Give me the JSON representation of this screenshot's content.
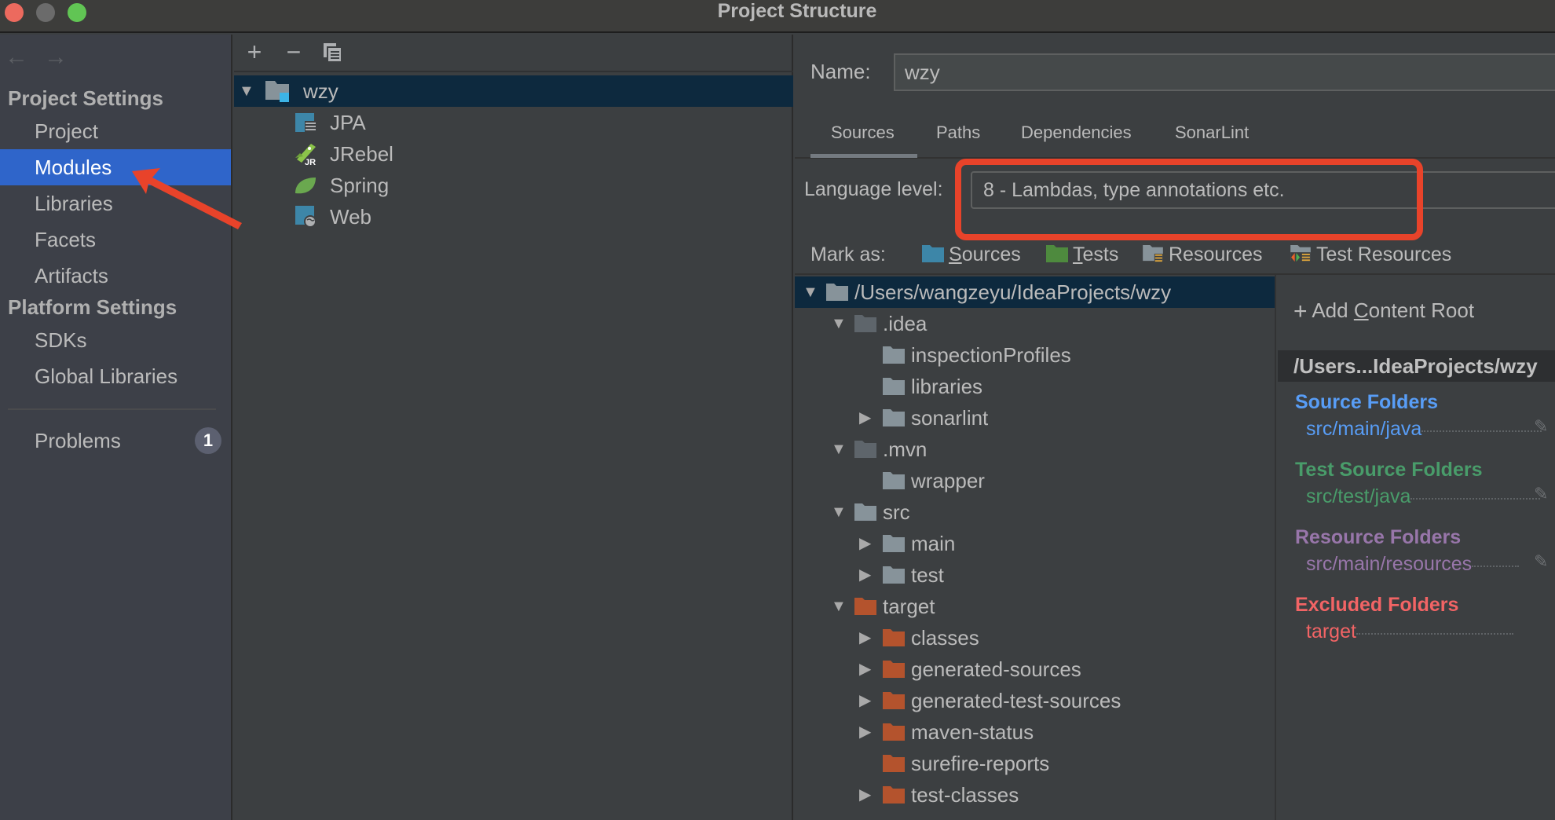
{
  "window": {
    "title": "Project Structure",
    "traffic_lights": [
      "close",
      "minimize",
      "maximize"
    ]
  },
  "sidebar": {
    "nav_back_icon": "←",
    "nav_forward_icon": "→",
    "sections": [
      {
        "heading": "Project Settings",
        "items": [
          "Project",
          "Modules",
          "Libraries",
          "Facets",
          "Artifacts"
        ]
      },
      {
        "heading": "Platform Settings",
        "items": [
          "SDKs",
          "Global Libraries"
        ]
      }
    ],
    "selected": "Modules",
    "problems": {
      "label": "Problems",
      "count": "1"
    }
  },
  "modules_panel": {
    "toolbar": {
      "add": "+",
      "remove": "−",
      "copy": "copy"
    },
    "tree": [
      {
        "label": "wzy",
        "type": "module",
        "expanded": true,
        "selected": true
      },
      {
        "label": "JPA",
        "type": "facet-jpa"
      },
      {
        "label": "JRebel",
        "type": "facet-jrebel"
      },
      {
        "label": "Spring",
        "type": "facet-spring"
      },
      {
        "label": "Web",
        "type": "facet-web"
      }
    ]
  },
  "module_settings": {
    "name_label": "Name:",
    "name_value": "wzy",
    "tabs": [
      "Sources",
      "Paths",
      "Dependencies",
      "SonarLint"
    ],
    "active_tab": "Sources",
    "language_level_label": "Language level:",
    "language_level_value": "8 - Lambdas, type annotations etc.",
    "mark_as_label": "Mark as:",
    "mark_as": [
      {
        "label": "Sources",
        "mnemonic": "S",
        "rest": "ources",
        "color": "#3d86a8"
      },
      {
        "label": "Tests",
        "mnemonic": "T",
        "rest": "ests",
        "color": "#4e8a3e"
      },
      {
        "label": "Resources",
        "color": "#87939a"
      },
      {
        "label": "Test Resources",
        "color": "#87939a"
      }
    ]
  },
  "content_tree": [
    {
      "label": "/Users/wangzeyu/IdeaProjects/wzy",
      "depth": 0,
      "toggle": "expanded",
      "kind": "root",
      "selected": true
    },
    {
      "label": ".idea",
      "depth": 1,
      "toggle": "expanded",
      "kind": "hidden"
    },
    {
      "label": "inspectionProfiles",
      "depth": 2,
      "toggle": "none",
      "kind": "normal"
    },
    {
      "label": "libraries",
      "depth": 2,
      "toggle": "none",
      "kind": "normal"
    },
    {
      "label": "sonarlint",
      "depth": 2,
      "toggle": "collapsed",
      "kind": "normal"
    },
    {
      "label": ".mvn",
      "depth": 1,
      "toggle": "expanded",
      "kind": "hidden"
    },
    {
      "label": "wrapper",
      "depth": 2,
      "toggle": "none",
      "kind": "normal"
    },
    {
      "label": "src",
      "depth": 1,
      "toggle": "expanded",
      "kind": "normal"
    },
    {
      "label": "main",
      "depth": 2,
      "toggle": "collapsed",
      "kind": "normal"
    },
    {
      "label": "test",
      "depth": 2,
      "toggle": "collapsed",
      "kind": "normal"
    },
    {
      "label": "target",
      "depth": 1,
      "toggle": "expanded",
      "kind": "excluded"
    },
    {
      "label": "classes",
      "depth": 2,
      "toggle": "collapsed",
      "kind": "excluded"
    },
    {
      "label": "generated-sources",
      "depth": 2,
      "toggle": "collapsed",
      "kind": "excluded"
    },
    {
      "label": "generated-test-sources",
      "depth": 2,
      "toggle": "collapsed",
      "kind": "excluded"
    },
    {
      "label": "maven-status",
      "depth": 2,
      "toggle": "collapsed",
      "kind": "excluded"
    },
    {
      "label": "surefire-reports",
      "depth": 2,
      "toggle": "none",
      "kind": "excluded"
    },
    {
      "label": "test-classes",
      "depth": 2,
      "toggle": "collapsed",
      "kind": "excluded"
    }
  ],
  "content_roots": {
    "add_label_pre": "Add ",
    "add_label_mnemonic": "C",
    "add_label_post": "ontent Root",
    "root_header": "/Users...IdeaProjects/wzy",
    "groups": [
      {
        "title": "Source Folders",
        "path": "src/main/java",
        "color": "#589df6"
      },
      {
        "title": "Test Source Folders",
        "path": "src/test/java",
        "color": "#499c6a"
      },
      {
        "title": "Resource Folders",
        "path": "src/main/resources",
        "color": "#9876aa"
      },
      {
        "title": "Excluded Folders",
        "path": "target",
        "color": "#f26465"
      }
    ]
  },
  "annotation": {
    "color": "#e8432a"
  },
  "colors": {
    "selection": "#2f65ca",
    "tree_selection": "#0d293e",
    "folder_normal": "#87939a",
    "folder_hidden": "#5e656b",
    "folder_excluded": "#b4532d"
  }
}
